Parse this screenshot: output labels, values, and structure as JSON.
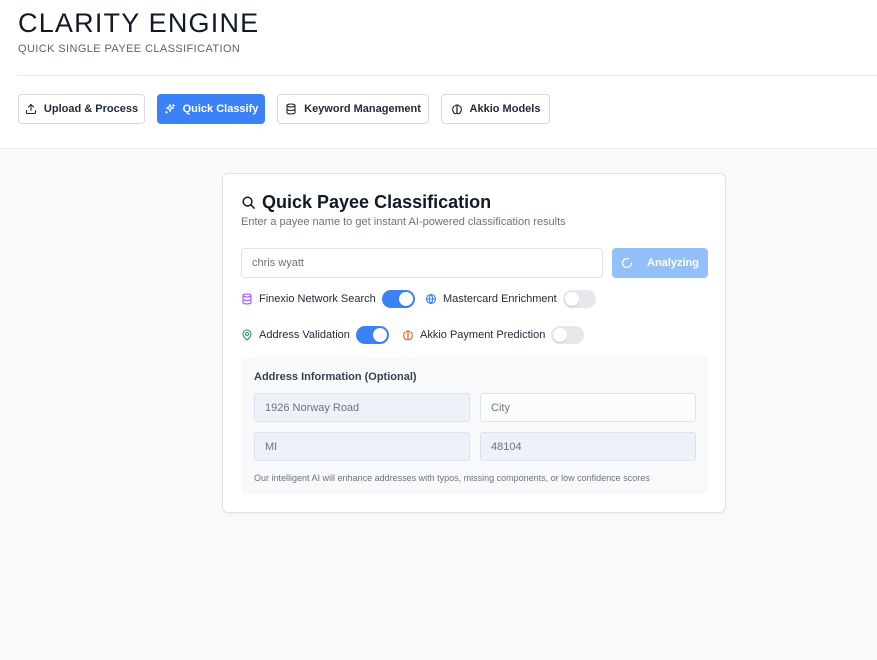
{
  "app": {
    "title": "CLARITY ENGINE",
    "subtitle": "QUICK SINGLE PAYEE CLASSIFICATION"
  },
  "tabs": [
    {
      "label": "Upload & Process",
      "icon": "upload-icon",
      "active": false
    },
    {
      "label": "Quick Classify",
      "icon": "sparkles-icon",
      "active": true
    },
    {
      "label": "Keyword Management",
      "icon": "database-icon",
      "active": false
    },
    {
      "label": "Akkio Models",
      "icon": "brain-icon",
      "active": false
    }
  ],
  "card": {
    "title": "Quick Payee Classification",
    "description": "Enter a payee name to get instant AI-powered classification results",
    "payee_value": "chris wyatt",
    "analyze_label": "Analyzing"
  },
  "options": [
    {
      "label": "Finexio Network Search",
      "icon": "database-icon",
      "icon_color": "#a855f7",
      "enabled": true
    },
    {
      "label": "Mastercard Enrichment",
      "icon": "globe-icon",
      "icon_color": "#3b82f6",
      "enabled": false
    },
    {
      "label": "Address Validation",
      "icon": "map-pin-icon",
      "icon_color": "#22a05a",
      "enabled": true
    },
    {
      "label": "Akkio Payment Prediction",
      "icon": "brain-icon",
      "icon_color": "#ea6a1f",
      "enabled": false
    }
  ],
  "address": {
    "title": "Address Information (Optional)",
    "street_value": "1926 Norway Road",
    "city_placeholder": "City",
    "state_value": "MI",
    "zip_value": "48104",
    "note": "Our intelligent AI will enhance addresses with typos, missing components, or low confidence scores"
  },
  "colors": {
    "accent": "#3b82f6",
    "accent_disabled": "#93c0f8"
  }
}
